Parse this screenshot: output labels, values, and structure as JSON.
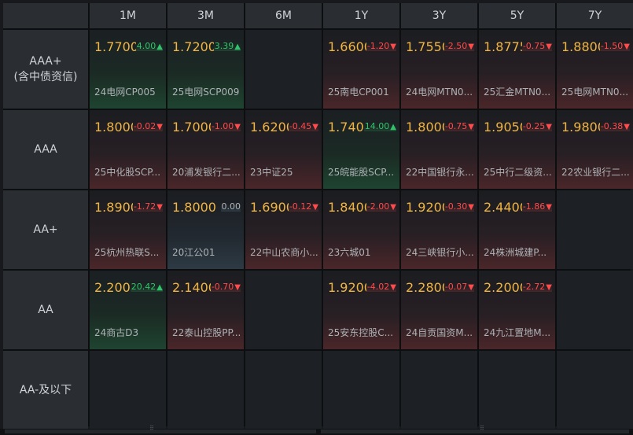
{
  "columns": [
    "1M",
    "3M",
    "6M",
    "1Y",
    "3Y",
    "5Y",
    "7Y"
  ],
  "rows": [
    {
      "label": "AAA+",
      "sublabel": "(含中债资信)",
      "cells": [
        {
          "value": "1.7700",
          "change": "4.00",
          "dir": "up",
          "bond": "24电网CP005"
        },
        {
          "value": "1.7200",
          "change": "3.39",
          "dir": "up",
          "bond": "25电网SCP009"
        },
        null,
        {
          "value": "1.6600",
          "change": "-1.20",
          "dir": "down",
          "bond": "25南电CP001"
        },
        {
          "value": "1.7550",
          "change": "-2.50",
          "dir": "down",
          "bond": "24电网MTN0..."
        },
        {
          "value": "1.8775",
          "change": "-0.75",
          "dir": "down",
          "bond": "25汇金MTN0..."
        },
        {
          "value": "1.8800",
          "change": "-1.50",
          "dir": "down",
          "bond": "25电网MTN0..."
        }
      ]
    },
    {
      "label": "AAA",
      "sublabel": "",
      "cells": [
        {
          "value": "1.8000",
          "change": "-0.02",
          "dir": "down",
          "bond": "25中化股SCP..."
        },
        {
          "value": "1.7000",
          "change": "-1.00",
          "dir": "down",
          "bond": "20浦发银行二..."
        },
        {
          "value": "1.6200",
          "change": "-0.45",
          "dir": "down",
          "bond": "23中证25"
        },
        {
          "value": "1.7400",
          "change": "14.00",
          "dir": "up",
          "bond": "25皖能股SCP..."
        },
        {
          "value": "1.8000",
          "change": "-0.75",
          "dir": "down",
          "bond": "22中国银行永..."
        },
        {
          "value": "1.9050",
          "change": "-0.25",
          "dir": "down",
          "bond": "25中行二级资..."
        },
        {
          "value": "1.9800",
          "change": "-0.38",
          "dir": "down",
          "bond": "22农业银行二..."
        }
      ]
    },
    {
      "label": "AA+",
      "sublabel": "",
      "cells": [
        {
          "value": "1.8900",
          "change": "-1.72",
          "dir": "down",
          "bond": "25杭州热联S..."
        },
        {
          "value": "1.8000",
          "change": "0.00",
          "dir": "flat",
          "bond": "20江公01"
        },
        {
          "value": "1.6900",
          "change": "-0.12",
          "dir": "down",
          "bond": "22中山农商小..."
        },
        {
          "value": "1.8400",
          "change": "-2.00",
          "dir": "down",
          "bond": "23六城01"
        },
        {
          "value": "1.9200",
          "change": "-0.30",
          "dir": "down",
          "bond": "24三峡银行小..."
        },
        {
          "value": "2.4400",
          "change": "-1.86",
          "dir": "down",
          "bond": "24株洲城建P..."
        },
        null
      ]
    },
    {
      "label": "AA",
      "sublabel": "",
      "cells": [
        {
          "value": "2.2000",
          "change": "20.42",
          "dir": "up",
          "bond": "24商古D3"
        },
        {
          "value": "2.1400",
          "change": "-0.70",
          "dir": "down",
          "bond": "22泰山控股PP..."
        },
        null,
        {
          "value": "1.9200",
          "change": "-4.02",
          "dir": "down",
          "bond": "25安东控股C..."
        },
        {
          "value": "2.2800",
          "change": "-0.07",
          "dir": "down",
          "bond": "24自贡国资M..."
        },
        {
          "value": "2.2000",
          "change": "-2.72",
          "dir": "down",
          "bond": "24九江置地M..."
        },
        null
      ]
    },
    {
      "label": "AA-及以下",
      "sublabel": "",
      "cells": [
        null,
        null,
        null,
        null,
        null,
        null,
        null
      ]
    }
  ],
  "arrows": {
    "up": "▲",
    "down": "▼",
    "flat": ""
  }
}
